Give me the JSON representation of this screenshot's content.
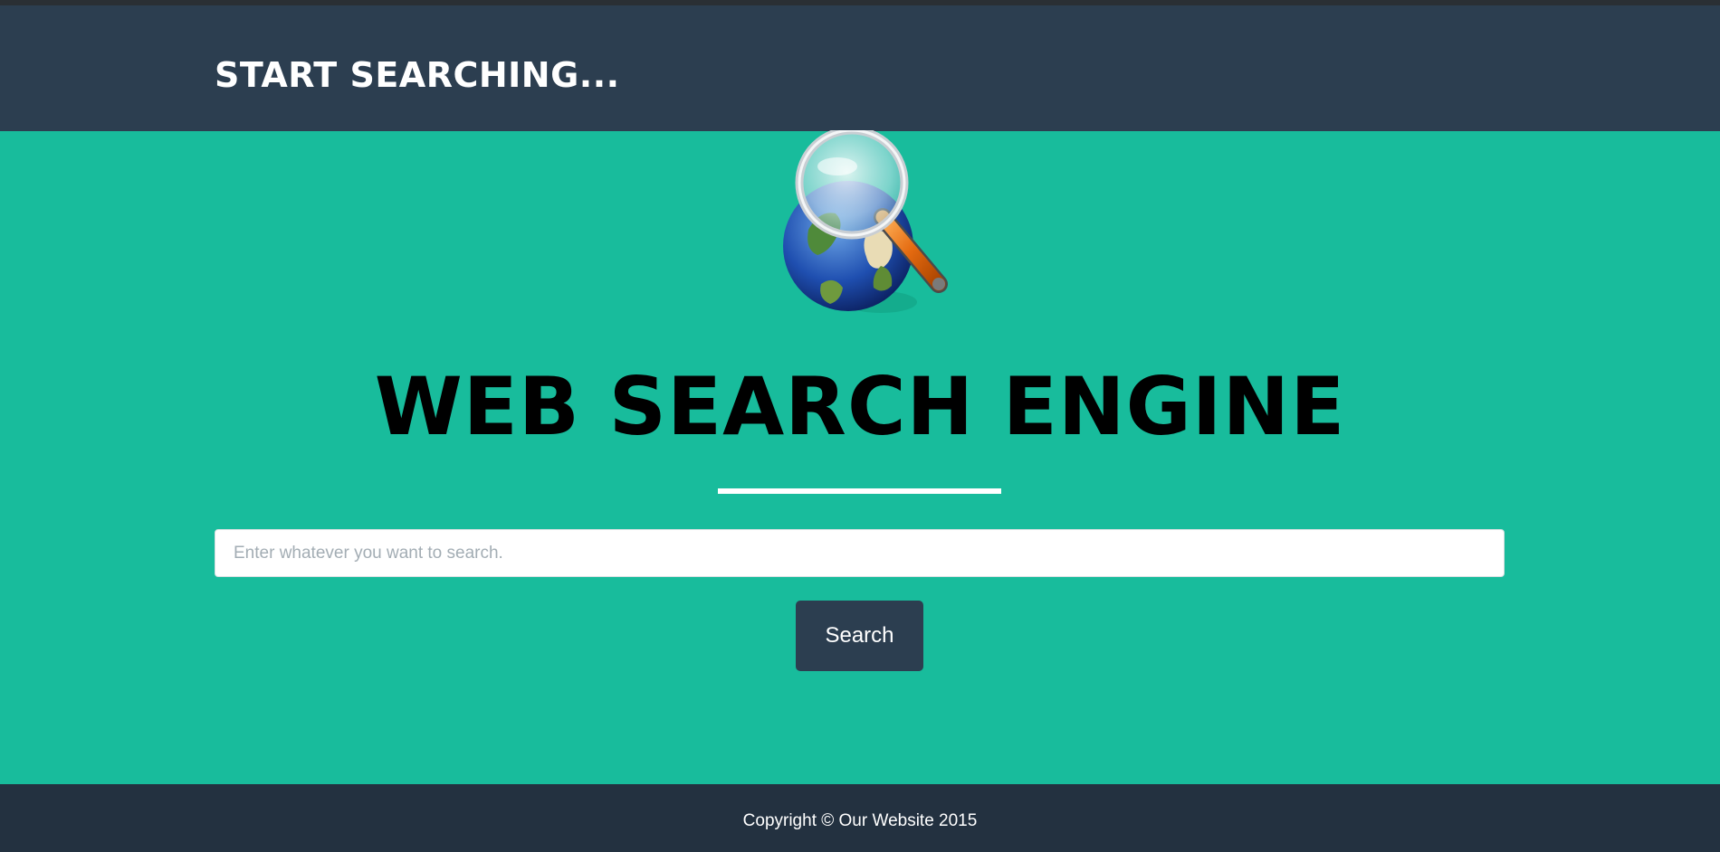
{
  "navbar": {
    "brand": "START SEARCHING..."
  },
  "hero": {
    "logo_icon": "globe-magnifier-icon",
    "title": "WEB SEARCH ENGINE"
  },
  "search": {
    "placeholder": "Enter whatever you want to search.",
    "value": "",
    "button_label": "Search"
  },
  "footer": {
    "copyright": "Copyright © Our Website 2015"
  },
  "colors": {
    "navbar_bg": "#2c3e50",
    "hero_bg": "#18bc9c",
    "footer_bg": "#233140",
    "button_bg": "#2c3e50",
    "text_light": "#ffffff"
  }
}
